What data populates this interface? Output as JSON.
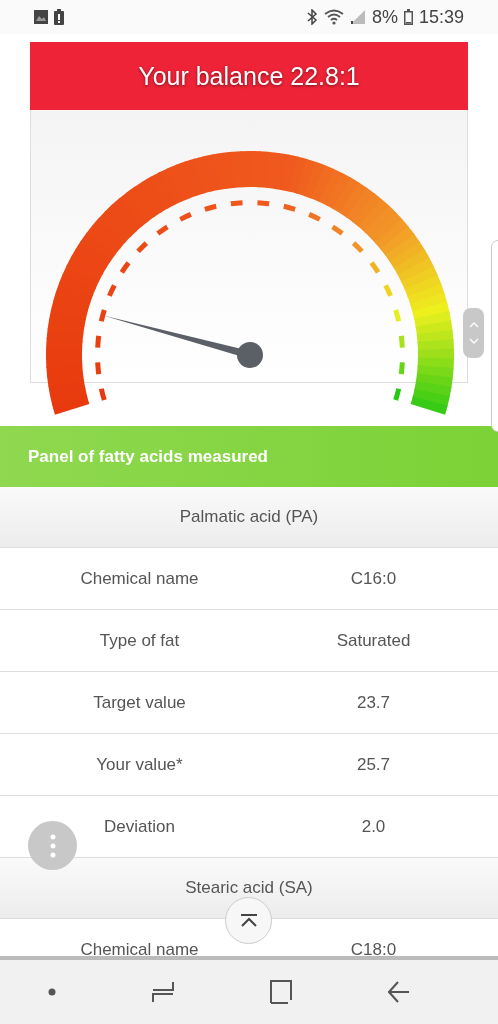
{
  "status_bar": {
    "battery_percent": "8%",
    "time": "15:39"
  },
  "balance_banner": {
    "title": "Your balance 22.8:1"
  },
  "panel": {
    "title": "Panel of fatty acids measured"
  },
  "acids": [
    {
      "name": "Palmatic acid (PA)",
      "rows": [
        {
          "label": "Chemical name",
          "value": "C16:0"
        },
        {
          "label": "Type of fat",
          "value": "Saturated"
        },
        {
          "label": "Target value",
          "value": "23.7"
        },
        {
          "label": "Your value*",
          "value": "25.7"
        },
        {
          "label": "Deviation",
          "value": "2.0"
        }
      ]
    },
    {
      "name": "Stearic acid (SA)",
      "rows": [
        {
          "label": "Chemical name",
          "value": "C18:0"
        }
      ]
    }
  ]
}
